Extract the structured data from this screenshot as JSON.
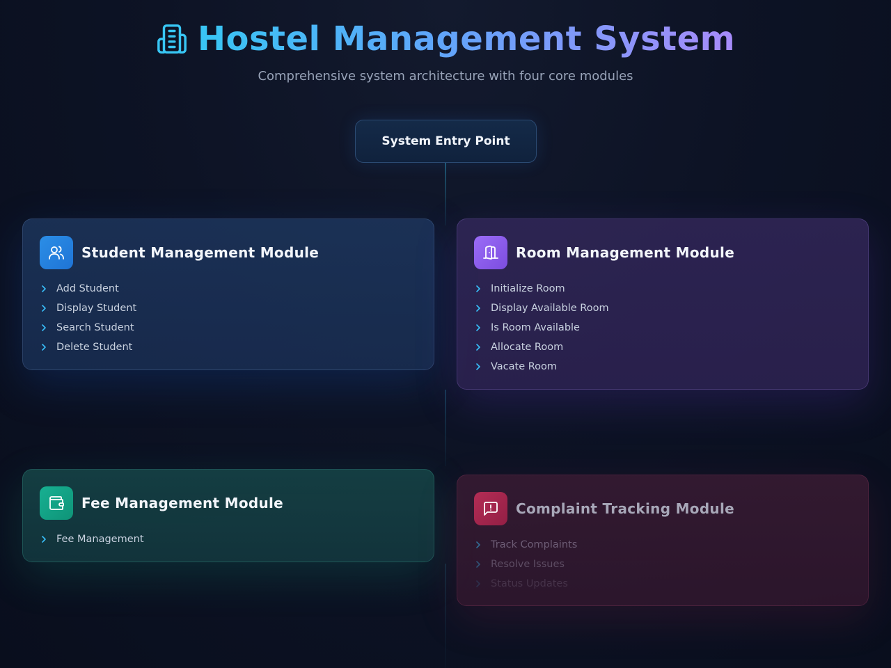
{
  "header": {
    "title": "Hostel Management System",
    "subtitle": "Comprehensive system architecture with four core modules",
    "logo_icon": "building-icon"
  },
  "entry": {
    "label": "System Entry Point"
  },
  "modules": {
    "student": {
      "title": "Student Management Module",
      "icon": "users-icon",
      "color": "#2b8ee6",
      "items": [
        "Add Student",
        "Display Student",
        "Search Student",
        "Delete Student"
      ]
    },
    "room": {
      "title": "Room Management Module",
      "icon": "door-icon",
      "color": "#8b5cf6",
      "items": [
        "Initialize Room",
        "Display Available Room",
        "Is Room Available",
        "Allocate Room",
        "Vacate Room"
      ]
    },
    "fee": {
      "title": "Fee Management Module",
      "icon": "wallet-icon",
      "color": "#14a38a",
      "items": [
        "Fee Management"
      ]
    },
    "complaint": {
      "title": "Complaint Tracking Module",
      "icon": "message-alert-icon",
      "color": "#b0294f",
      "items": [
        "Track Complaints",
        "Resolve Issues",
        "Status Updates"
      ]
    }
  },
  "colors": {
    "accent_cyan": "#38c6f4",
    "accent_purple": "#a78bfa",
    "chevron": "#38bdf8"
  }
}
